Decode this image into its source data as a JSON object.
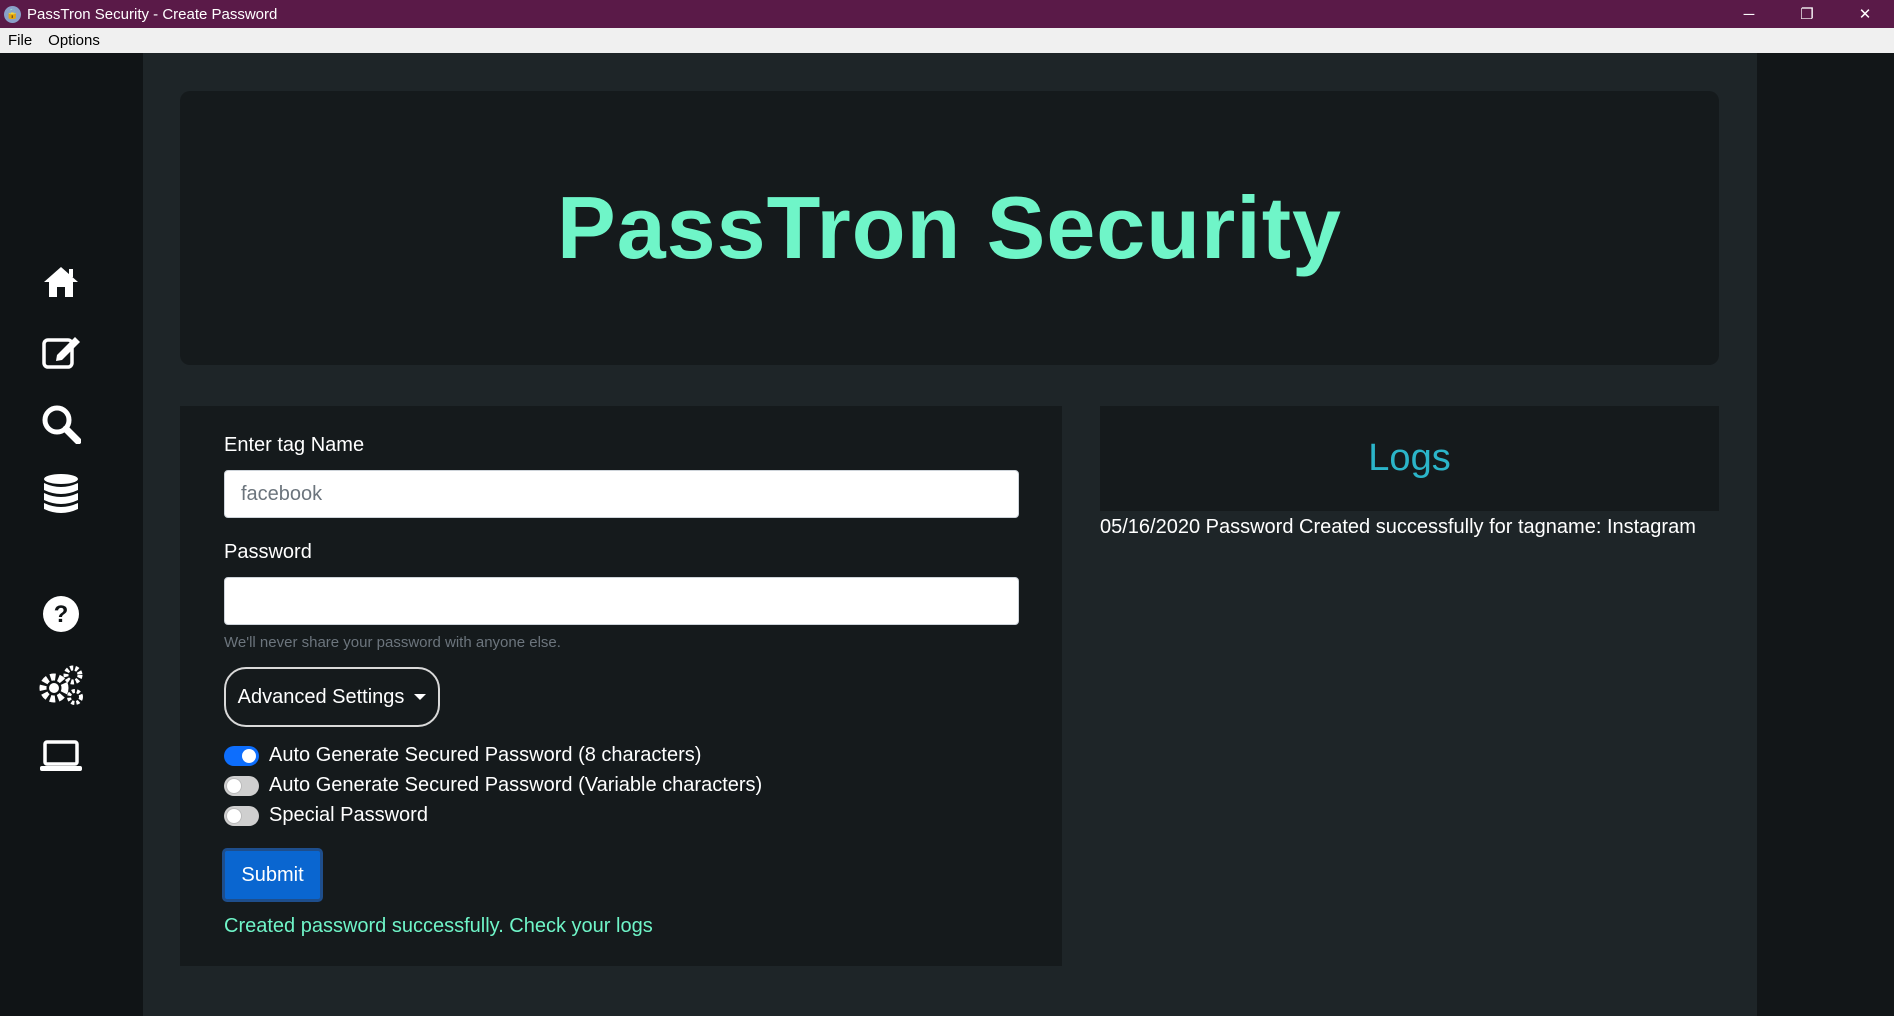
{
  "window": {
    "title": "PassTron Security - Create Password",
    "controls": {
      "minimize": "─",
      "restore": "❐",
      "close": "✕"
    }
  },
  "menubar": {
    "items": [
      "File",
      "Options"
    ]
  },
  "sidebar": {
    "icons": [
      "home-icon",
      "edit-icon",
      "search-icon",
      "database-icon",
      "help-icon",
      "settings-icon",
      "laptop-icon"
    ]
  },
  "hero": {
    "title": "PassTron Security"
  },
  "form": {
    "tag_label": "Enter tag Name",
    "tag_value": "facebook",
    "password_label": "Password",
    "password_value": "",
    "help_text": "We'll never share your password with anyone else.",
    "advanced_label": "Advanced Settings",
    "switches": [
      {
        "label": "Auto Generate Secured Password (8 characters)",
        "checked": true
      },
      {
        "label": "Auto Generate Secured Password (Variable characters)",
        "checked": false
      },
      {
        "label": "Special Password",
        "checked": false
      }
    ],
    "submit_label": "Submit",
    "success_message": "Created password successfully. Check your logs"
  },
  "logs": {
    "title": "Logs",
    "entries": [
      "05/16/2020 Password Created successfully for tagname: Instagram"
    ]
  },
  "colors": {
    "accent_mint": "#6ff5c8",
    "logs_title": "#2bb5c9",
    "titlebar": "#5a1a48",
    "primary_button": "#0a66d0"
  }
}
